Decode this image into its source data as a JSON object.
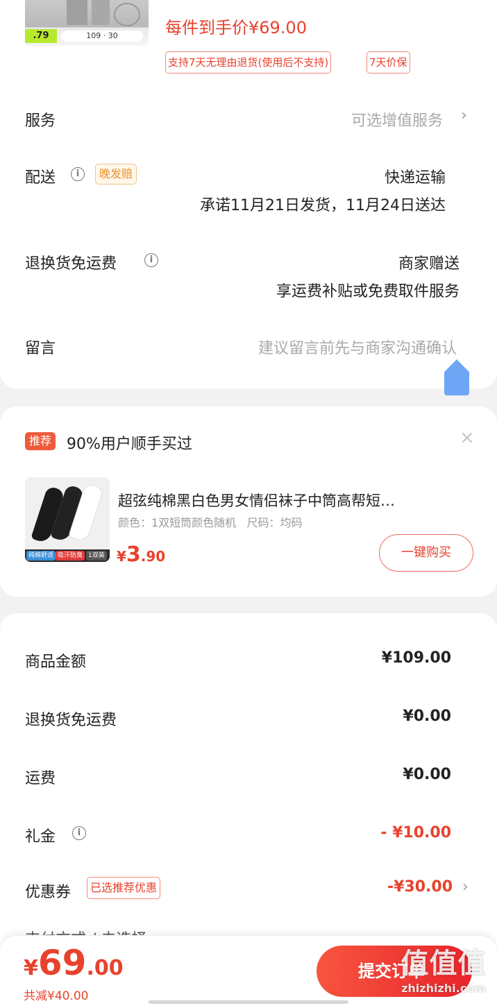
{
  "product": {
    "thumb_price": ".79",
    "thumb_sizes": "109 · 30",
    "final_price": "每件到手价¥69.00",
    "tags": [
      "支持7天无理由退货(使用后不支持)",
      "7天价保"
    ]
  },
  "rows": {
    "service": {
      "label": "服务",
      "value": "可选增值服务"
    },
    "delivery": {
      "label": "配送",
      "badge": "晚发赔",
      "method": "快递运输",
      "promise": "承诺11月21日发货，11月24日送达"
    },
    "return_ship": {
      "label": "退换货免运费",
      "value": "商家赠送",
      "sub": "享运费补贴或免费取件服务"
    },
    "message": {
      "label": "留言",
      "placeholder": "建议留言前先与商家沟通确认"
    }
  },
  "recommend": {
    "badge": "推荐",
    "title": "90%用户顺手买过",
    "item_name": "超弦纯棉黑白色男女情侣袜子中筒高帮短…",
    "item_specs": "颜色：1双短筒颜色随机   尺码：均码",
    "thumb_tags": [
      "纯棉舒适",
      "吸汗防臭",
      "1双装"
    ],
    "price_currency": "¥",
    "price_int": "3",
    "price_dec": ".90",
    "buy_label": "一键购买"
  },
  "summary": {
    "items": [
      {
        "label": "商品金额",
        "value": "¥109.00"
      },
      {
        "label": "退换货免运费",
        "value": "¥0.00"
      },
      {
        "label": "运费",
        "value": "¥0.00"
      },
      {
        "label": "礼金",
        "value": "- ¥10.00"
      },
      {
        "label": "优惠券",
        "tag": "已选推荐优惠",
        "value": "-¥30.00"
      }
    ],
    "partial_row": "支付方式 / 未选择"
  },
  "bottom": {
    "currency": "¥",
    "total_int": "69",
    "total_dec": ".00",
    "saved": "共减¥40.00",
    "submit": "提交订单"
  },
  "watermark": {
    "big": "值值值",
    "small": "zhizhizhi.com"
  },
  "colors": {
    "accent": "#e8422d",
    "badge_orange": "#e8902a",
    "fab_blue": "#6ea6f5"
  }
}
